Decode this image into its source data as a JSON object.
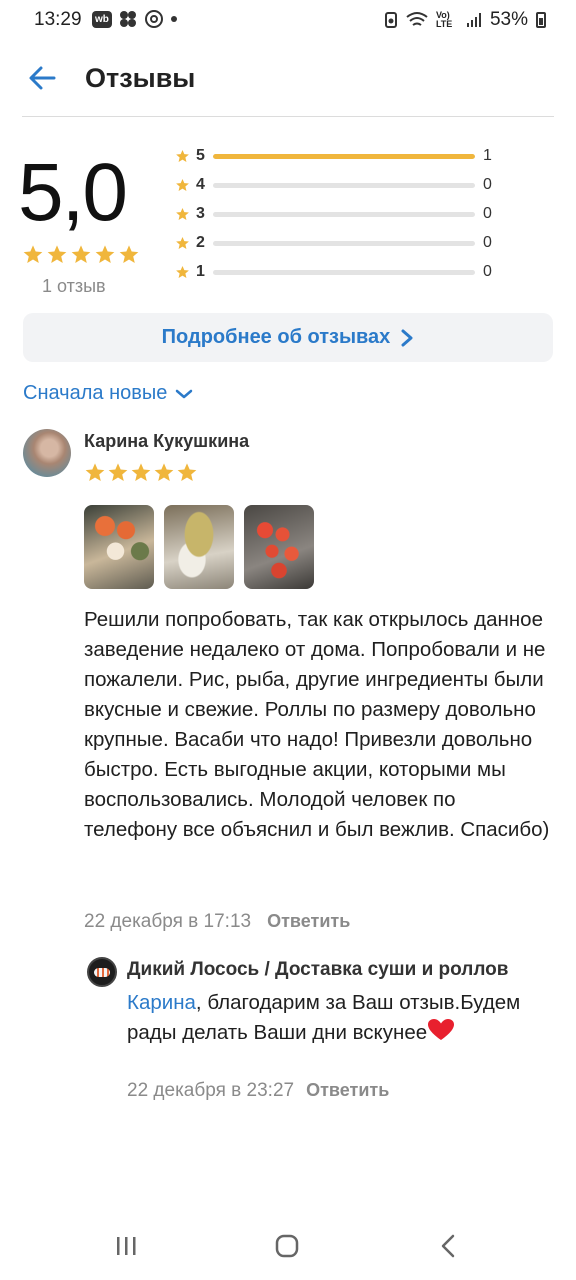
{
  "status_bar": {
    "time": "13:29",
    "app_badge": "wb",
    "battery": "53%",
    "signal_label": "Vo) LTE"
  },
  "header": {
    "title": "Отзывы",
    "back_icon": "arrow-left-icon"
  },
  "summary": {
    "score": "5,0",
    "reviews_count": "1 отзыв",
    "star_color": "#f0b63c",
    "distribution": [
      {
        "stars": "5",
        "count": "1",
        "fraction": 1.0
      },
      {
        "stars": "4",
        "count": "0",
        "fraction": 0
      },
      {
        "stars": "3",
        "count": "0",
        "fraction": 0
      },
      {
        "stars": "2",
        "count": "0",
        "fraction": 0
      },
      {
        "stars": "1",
        "count": "0",
        "fraction": 0
      }
    ],
    "more_button": "Подробнее об отзывах"
  },
  "sort": {
    "label": "Сначала новые"
  },
  "review": {
    "author": "Карина Кукушкина",
    "rating": 5,
    "text": "Решили попробовать, так как открылось данное заведение недалеко от дома. Попробовали и не пожалели. Рис, рыба, другие ингредиенты были вкусные и свежие. Роллы по размеру довольно крупные. Васаби что надо! Привезли довольно быстро.  Есть выгодные акции, которыми мы воспользовались. Молодой человек по телефону все объяснил и был вежлив. Спасибо)",
    "date": "22 декабря в 17:13",
    "reply_label": "Ответить"
  },
  "shop_reply": {
    "name": "Дикий Лосось / Доставка суши и роллов",
    "mention": "Карина",
    "text": ", благодарим за Ваш отзыв.Будем рады делать Ваши дни вскунее",
    "date": "22 декабря в 23:27",
    "reply_label": "Ответить"
  },
  "colors": {
    "accent": "#2b7ac9",
    "muted": "#8a8a8a"
  }
}
